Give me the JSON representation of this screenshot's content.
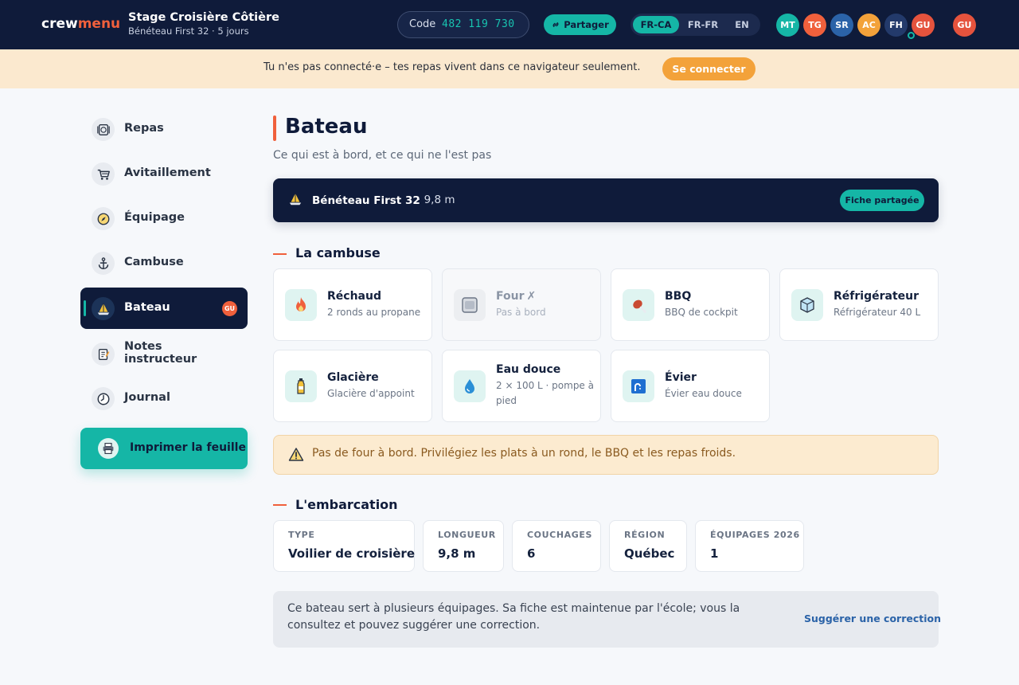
{
  "header": {
    "logo_crew": "crew",
    "logo_menu": "menu",
    "trip_title": "Stage Croisière Côtière",
    "trip_subtitle": "Bénéteau First 32 · 5 jours",
    "code_label": "Code",
    "code_value": "482 119 730",
    "share_label": "Partager",
    "languages": [
      {
        "label": "FR-CA",
        "active": true
      },
      {
        "label": "FR-FR",
        "active": false
      },
      {
        "label": "EN",
        "active": false
      }
    ],
    "crew_avatars": [
      {
        "initials": "MT",
        "color": "#15b6a6"
      },
      {
        "initials": "TG",
        "color": "#f0603c"
      },
      {
        "initials": "SR",
        "color": "#2b63a8"
      },
      {
        "initials": "AC",
        "color": "#f3a23a"
      },
      {
        "initials": "FH",
        "color": "#233a6b"
      },
      {
        "initials": "GU",
        "color": "#e5533d"
      }
    ],
    "current_user": {
      "initials": "GU",
      "color": "#e5533d"
    }
  },
  "banner": {
    "text": "Tu n'es pas connecté·e – tes repas vivent dans ce navigateur seulement.",
    "button": "Se connecter"
  },
  "sidebar": {
    "items": [
      {
        "label": "Repas",
        "icon": "plate-icon",
        "active": false
      },
      {
        "label": "Avitaillement",
        "icon": "cart-icon",
        "active": false
      },
      {
        "label": "Équipage",
        "icon": "compass-icon",
        "active": false
      },
      {
        "label": "Cambuse",
        "icon": "anchor-icon",
        "active": false
      },
      {
        "label": "Bateau",
        "icon": "sailboat-icon",
        "active": true,
        "badge": "GU"
      },
      {
        "label": "Notes instructeur",
        "icon": "notepad-icon",
        "active": false
      },
      {
        "label": "Journal",
        "icon": "clock-icon",
        "active": false
      }
    ],
    "print_button": "Imprimer la feuille"
  },
  "main": {
    "title": "Bateau",
    "subtitle": "Ce qui est à bord, et ce qui ne l'est pas",
    "boat": {
      "name": "Bénéteau First 32",
      "length": "· 9,8 m",
      "shared_badge": "Fiche partagée"
    },
    "galley": {
      "title": "La cambuse",
      "items": [
        {
          "title": "Réchaud",
          "desc": "2 ronds au propane",
          "icon": "flame-icon",
          "available": true
        },
        {
          "title": "Four",
          "mark": "✗",
          "desc": "Pas à bord",
          "icon": "oven-icon",
          "available": false
        },
        {
          "title": "BBQ",
          "desc": "BBQ de cockpit",
          "icon": "meat-icon",
          "available": true
        },
        {
          "title": "Réfrigérateur",
          "desc": "Réfrigérateur 40 L",
          "icon": "ice-cube-icon",
          "available": true
        },
        {
          "title": "Glacière",
          "desc": "Glacière d'appoint",
          "icon": "bottle-icon",
          "available": true
        },
        {
          "title": "Eau douce",
          "desc": "2 × 100 L · pompe à pied",
          "icon": "droplet-icon",
          "available": true
        },
        {
          "title": "Évier",
          "desc": "Évier eau douce",
          "icon": "faucet-icon",
          "available": true
        }
      ]
    },
    "alert": "Pas de four à bord. Privilégiez les plats à un rond, le BBQ et les repas froids.",
    "vessel": {
      "title": "L'embarcation",
      "specs": [
        {
          "label": "TYPE",
          "value": "Voilier de croisière"
        },
        {
          "label": "LONGUEUR",
          "value": "9,8 m"
        },
        {
          "label": "COUCHAGES",
          "value": "6"
        },
        {
          "label": "RÉGION",
          "value": "Québec"
        },
        {
          "label": "ÉQUIPAGES 2026",
          "value": "1"
        }
      ]
    },
    "note": {
      "text": "Ce bateau sert à plusieurs équipages. Sa fiche est maintenue par l'école; vous la consultez et pouvez suggérer une correction.",
      "link": "Suggérer une correction"
    }
  }
}
